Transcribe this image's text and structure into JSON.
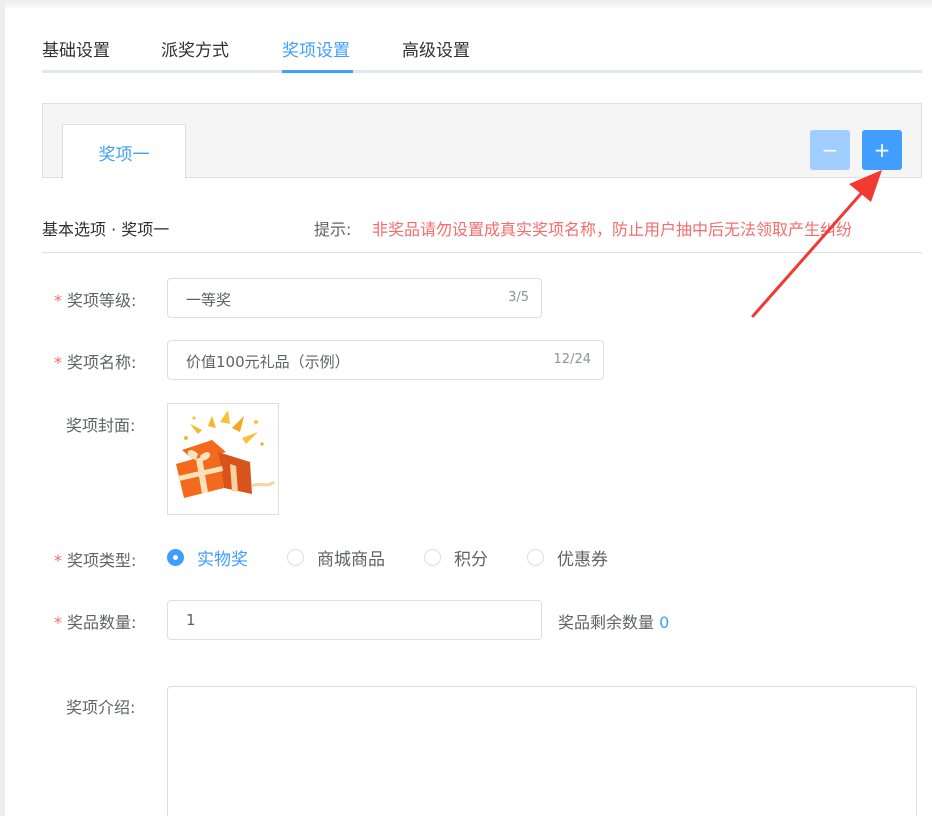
{
  "tabs": [
    {
      "label": "基础设置",
      "active": false
    },
    {
      "label": "派奖方式",
      "active": false
    },
    {
      "label": "奖项设置",
      "active": true
    },
    {
      "label": "高级设置",
      "active": false
    }
  ],
  "prize_tabs": {
    "items": [
      "奖项一"
    ],
    "minus_label": "−",
    "plus_label": "+"
  },
  "section": {
    "title": "基本选项 · 奖项一",
    "tip_label": "提示:",
    "tip_text": "非奖品请勿设置成真实奖项名称，防止用户抽中后无法领取产生纠纷"
  },
  "form": {
    "required_mark": "*",
    "level": {
      "label": "奖项等级:",
      "value": "一等奖",
      "count": "3/5"
    },
    "name": {
      "label": "奖项名称:",
      "value": "价值100元礼品（示例）",
      "count": "12/24"
    },
    "cover": {
      "label": "奖项封面:"
    },
    "type": {
      "label": "奖项类型:",
      "options": [
        "实物奖",
        "商城商品",
        "积分",
        "优惠券"
      ],
      "selected": "实物奖"
    },
    "quantity": {
      "label": "奖品数量:",
      "value": "1",
      "remain_label": "奖品剩余数量",
      "remain_value": "0"
    },
    "intro": {
      "label": "奖项介绍:",
      "value": ""
    }
  },
  "colors": {
    "accent": "#409eff",
    "accent_light": "#a0cfff",
    "warning": "#f56c6c",
    "annotation_arrow": "#f03a32"
  },
  "icons": {
    "cover_image": "gift-box-image",
    "annotation": "red-arrow-pointing-to-plus-button"
  }
}
